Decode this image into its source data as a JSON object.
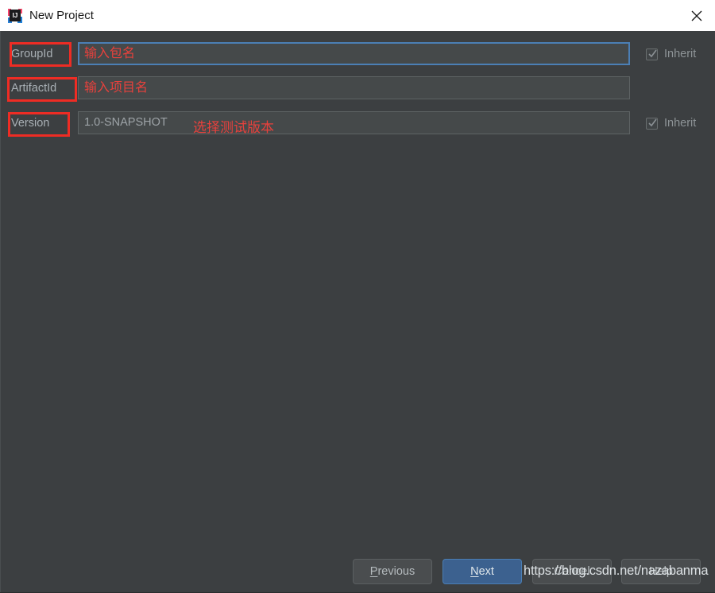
{
  "window": {
    "title": "New Project",
    "icon_name": "intellij-idea-icon",
    "icon_letters": "IJ",
    "close_label": "✕"
  },
  "form": {
    "fields": [
      {
        "label": "GroupId",
        "value": "",
        "placeholder": "输入包名",
        "focused": true,
        "inherit": {
          "label": "Inherit",
          "checked": true,
          "enabled": false
        },
        "annotation": ""
      },
      {
        "label": "ArtifactId",
        "value": "",
        "placeholder": "输入项目名",
        "focused": false,
        "inherit": null,
        "annotation": ""
      },
      {
        "label": "Version",
        "value": "1.0-SNAPSHOT",
        "placeholder": "",
        "focused": false,
        "inherit": {
          "label": "Inherit",
          "checked": true,
          "enabled": false
        },
        "annotation": "选择测试版本"
      }
    ]
  },
  "buttons": {
    "previous": {
      "label": "Previous",
      "mnemonic": "P",
      "primary": false
    },
    "next": {
      "label": "Next",
      "mnemonic": "N",
      "primary": true
    },
    "cancel": {
      "label": "Cancel",
      "mnemonic": "",
      "primary": false
    },
    "help": {
      "label": "Help",
      "mnemonic": "",
      "primary": false
    }
  },
  "watermark": {
    "text": "https://blog.csdn.net/nazabanma"
  },
  "colors": {
    "dialog_background": "#3c3f41",
    "titlebar_background": "#ffffff",
    "input_background": "#45494a",
    "focus_border": "#4b7fb5",
    "annotation_red": "#ee2c24",
    "primary_button": "#3c618f",
    "label_text": "#a9b0b5"
  }
}
